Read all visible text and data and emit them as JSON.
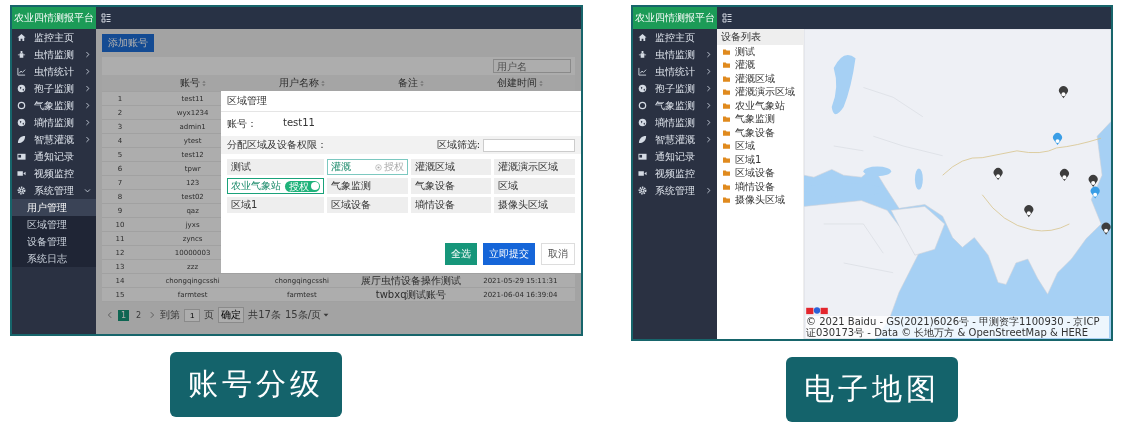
{
  "account_screen": {
    "brand": "农业四情测报平台",
    "sidebar": [
      {
        "label": "监控主页",
        "kind": "link"
      },
      {
        "label": "虫情监测",
        "kind": "group",
        "expanded": false
      },
      {
        "label": "虫情统计",
        "kind": "group",
        "expanded": false
      },
      {
        "label": "孢子监测",
        "kind": "group",
        "expanded": false
      },
      {
        "label": "气象监测",
        "kind": "group",
        "expanded": false
      },
      {
        "label": "墒情监测",
        "kind": "group",
        "expanded": false
      },
      {
        "label": "智慧灌溉",
        "kind": "group",
        "expanded": false
      },
      {
        "label": "通知记录",
        "kind": "link"
      },
      {
        "label": "视频监控",
        "kind": "link"
      },
      {
        "label": "系统管理",
        "kind": "group",
        "expanded": true,
        "children": [
          {
            "label": "用户管理",
            "selected": true
          },
          {
            "label": "区域管理",
            "selected": false
          },
          {
            "label": "设备管理",
            "selected": false
          },
          {
            "label": "系统日志",
            "selected": false
          }
        ]
      }
    ],
    "add_button": "添加账号",
    "search_placeholder": "用户名",
    "columns": [
      "账号",
      "用户名称",
      "备注",
      "创建时间"
    ],
    "rows": [
      {
        "index": "1",
        "account": "test11"
      },
      {
        "index": "2",
        "account": "wyx1234"
      },
      {
        "index": "3",
        "account": "admin1"
      },
      {
        "index": "4",
        "account": "ytest"
      },
      {
        "index": "5",
        "account": "test12"
      },
      {
        "index": "6",
        "account": "tpwr"
      },
      {
        "index": "7",
        "account": "123"
      },
      {
        "index": "8",
        "account": "test02"
      },
      {
        "index": "9",
        "account": "qaz"
      },
      {
        "index": "10",
        "account": "jyxs"
      },
      {
        "index": "11",
        "account": "zyncs"
      },
      {
        "index": "12",
        "account": "10000003"
      },
      {
        "index": "13",
        "account": "zzz"
      },
      {
        "index": "14",
        "account": "chongqingcsshi",
        "user_name": "chongqingcsshi",
        "note": "展厅虫情设备操作测试",
        "created": "2021-05-29 15:11:31"
      },
      {
        "index": "15",
        "account": "farmtest",
        "user_name": "farmtest",
        "note": "twbxq测试账号",
        "created": "2021-06-04 16:39:04"
      }
    ],
    "pagination": {
      "pages": [
        {
          "label": "1",
          "selected": true
        },
        {
          "label": "2",
          "selected": false
        }
      ],
      "goto_label": "到第",
      "goto_value": "1",
      "page_suffix": "页",
      "confirm": "确定",
      "total": "共17条",
      "page_size": "15条/页"
    },
    "dialog": {
      "title": "区域管理",
      "account_label": "账号：",
      "account_value": "test11",
      "section_label": "分配区域及设备权限：",
      "filter_label": "区域筛选:",
      "toggle_label": "授权",
      "hover_label": "授权",
      "cells": [
        {
          "label": "测试",
          "selected": false,
          "hovered": false
        },
        {
          "label": "灌溉",
          "selected": false,
          "hovered": true
        },
        {
          "label": "灌溉区域",
          "selected": false,
          "hovered": false
        },
        {
          "label": "灌溉演示区域",
          "selected": false,
          "hovered": false
        },
        {
          "label": "农业气象站",
          "selected": true,
          "hovered": false
        },
        {
          "label": "气象监测",
          "selected": false,
          "hovered": false
        },
        {
          "label": "气象设备",
          "selected": false,
          "hovered": false
        },
        {
          "label": "区域",
          "selected": false,
          "hovered": false
        },
        {
          "label": "区域1",
          "selected": false,
          "hovered": false
        },
        {
          "label": "区域设备",
          "selected": false,
          "hovered": false
        },
        {
          "label": "墒情设备",
          "selected": false,
          "hovered": false
        },
        {
          "label": "摄像头区域",
          "selected": false,
          "hovered": false
        }
      ],
      "buttons": [
        {
          "label": "全选",
          "kind": "success"
        },
        {
          "label": "立即提交",
          "kind": "primary"
        },
        {
          "label": "取消",
          "kind": "plain"
        }
      ]
    },
    "caption": "账号分级"
  },
  "map_screen": {
    "brand": "农业四情测报平台",
    "sidebar": [
      {
        "label": "监控主页",
        "kind": "link"
      },
      {
        "label": "虫情监测",
        "kind": "group",
        "expanded": false
      },
      {
        "label": "虫情统计",
        "kind": "group",
        "expanded": false
      },
      {
        "label": "孢子监测",
        "kind": "group",
        "expanded": false
      },
      {
        "label": "气象监测",
        "kind": "group",
        "expanded": false
      },
      {
        "label": "墒情监测",
        "kind": "group",
        "expanded": false
      },
      {
        "label": "智慧灌溉",
        "kind": "group",
        "expanded": false
      },
      {
        "label": "通知记录",
        "kind": "link"
      },
      {
        "label": "视频监控",
        "kind": "link"
      },
      {
        "label": "系统管理",
        "kind": "group",
        "expanded": false
      }
    ],
    "device_list": {
      "title": "设备列表",
      "items": [
        "测试",
        "灌溉",
        "灌溉区域",
        "灌溉演示区域",
        "农业气象站",
        "气象监测",
        "气象设备",
        "区域",
        "区域1",
        "区域设备",
        "墒情设备",
        "摄像头区域"
      ]
    },
    "map": {
      "markers": [
        {
          "color": "#3d3d3d"
        },
        {
          "color": "#3a9ee6"
        },
        {
          "color": "#3d3d3d"
        },
        {
          "color": "#3d3d3d"
        },
        {
          "color": "#3d3d3d"
        },
        {
          "color": "#3a9ee6"
        },
        {
          "color": "#3d3d3d"
        },
        {
          "color": "#3d3d3d"
        }
      ],
      "attribution": "© 2021 Baidu - GS(2021)6026号 - 甲测资字1100930 - 京ICP证030173号 - Data © 长地万方 & OpenStreetMap & HERE"
    },
    "caption": "电子地图"
  }
}
